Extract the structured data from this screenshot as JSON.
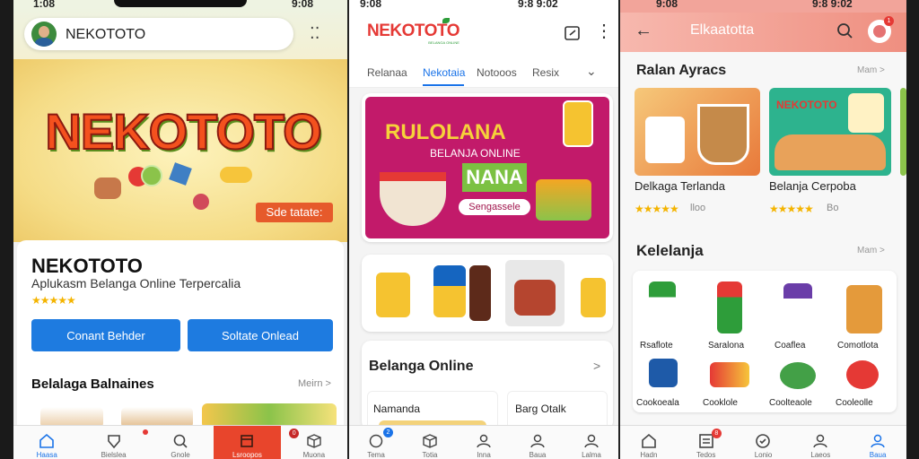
{
  "colors": {
    "primary": "#1a73e8",
    "brand_red": "#e53935",
    "brand_green": "#2e9d3a",
    "star": "#f4b400",
    "banner_magenta": "#c2185b"
  },
  "screen1": {
    "time": "1:08",
    "status_right": "9:08",
    "search": {
      "value": "NEKOTOTO",
      "avatar_icon": "avatar-icon",
      "menu_icon": "dots-icon"
    },
    "hero": {
      "logo_text": "NEKOTOTO",
      "tag_text": "Sde tatate:"
    },
    "app": {
      "name": "NEKOTOTO",
      "subtitle": "Aplukasm Belanga Online Terpercalia",
      "stars": "★★★★★"
    },
    "buttons": {
      "primary": "Conant Behder",
      "secondary": "Soltate Onlead"
    },
    "section": {
      "title": "Belalaga Balnaines",
      "more": "Meirn >"
    },
    "nav": [
      "Haasa",
      "Bielslea",
      "Gnole",
      "Lsroopos",
      "Muona"
    ]
  },
  "screen2": {
    "time": "9:08",
    "status_right": "9:8 9:02",
    "logo": "NEKOTOTO",
    "logo_sub": "BELANGA ONLINE",
    "tabs": [
      "Relanaa",
      "Nekotaia",
      "Notooos",
      "Resix"
    ],
    "banner": {
      "line1": "RULOLANA",
      "line2": "BELANJA ONLINE",
      "line3": "NANA",
      "chip": "Sengassele"
    },
    "section": {
      "title": "Belanga Online",
      "arrow": ">"
    },
    "items": [
      "Namanda",
      "Barg Otalk"
    ],
    "nav": [
      "Tema",
      "Totia",
      "Inna",
      "Baua",
      "Lalma"
    ],
    "badge_count": "2"
  },
  "screen3": {
    "time": "9:08",
    "status_right": "9:8 9:02",
    "title": "Elkaatotta",
    "section1": {
      "title": "Ralan Ayracs",
      "more": "Mam >"
    },
    "products": [
      {
        "name": "Delkaga Terlanda",
        "stars": "★★★★★",
        "count": "lloo"
      },
      {
        "name": "Belanja Cerpoba",
        "stars": "★★★★★",
        "count": "Bo"
      }
    ],
    "promo_logo": "NEKOTOTO",
    "section2": {
      "title": "Kelelanja",
      "more": "Mam >"
    },
    "grid": [
      {
        "name": "Rsaflote"
      },
      {
        "name": "Saralona"
      },
      {
        "name": "Coaflea"
      },
      {
        "name": "Comotlota"
      },
      {
        "name": "Cookoeala"
      },
      {
        "name": "Cooklole"
      },
      {
        "name": "Coolteaole"
      },
      {
        "name": "Cooleolle"
      }
    ],
    "nav": [
      "Hadn",
      "Tedos",
      "Lonio",
      "Laeos",
      "Baua"
    ],
    "badge_count": "1"
  }
}
